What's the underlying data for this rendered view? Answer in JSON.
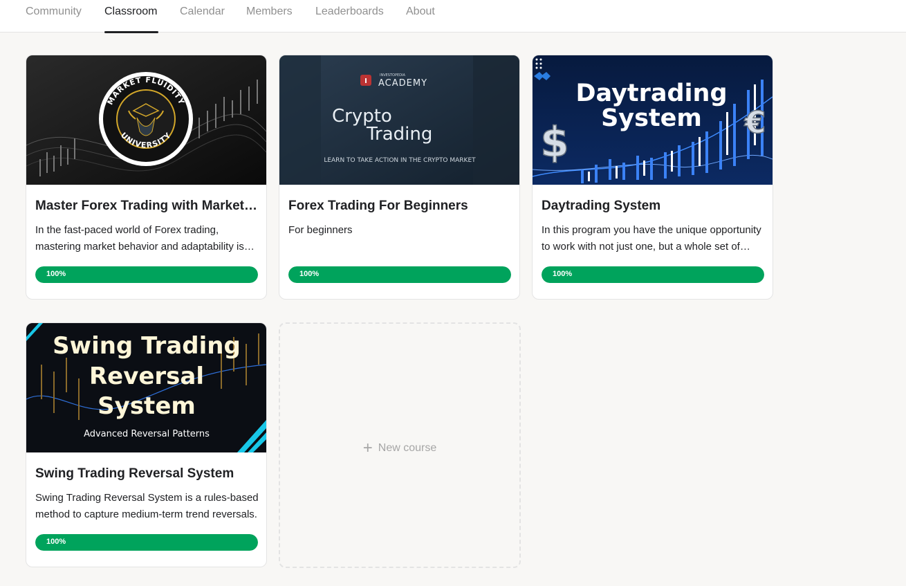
{
  "nav": {
    "tabs": [
      {
        "label": "Community"
      },
      {
        "label": "Classroom",
        "active": true
      },
      {
        "label": "Calendar"
      },
      {
        "label": "Members"
      },
      {
        "label": "Leaderboards"
      },
      {
        "label": "About"
      }
    ]
  },
  "courses": [
    {
      "title": "Master Forex Trading with Market Fluidity University",
      "description": "In the fast-paced world of Forex trading, mastering market behavior and adaptability is key to long-term success.",
      "progress_label": "100%",
      "progress": 1.0,
      "thumbnail": {
        "badge_top": "MARKET FLUIDITY",
        "badge_bottom": "UNIVERSITY"
      }
    },
    {
      "title": "Forex Trading For Beginners",
      "description": "For beginners",
      "progress_label": "100%",
      "progress": 1.0,
      "thumbnail": {
        "brand_small": "INVESTOPEDIA",
        "brand": "ACADEMY",
        "line1": "Crypto",
        "line2": "Trading",
        "tagline": "LEARN TO TAKE ACTION IN THE CRYPTO MARKET"
      }
    },
    {
      "title": "Daytrading System",
      "description": "In this program you have the unique opportunity to work with not just one, but a whole set of strategies.",
      "progress_label": "100%",
      "progress": 1.0,
      "thumbnail": {
        "line1": "Daytrading",
        "line2": "System",
        "symbol_left": "$",
        "symbol_right": "€"
      }
    },
    {
      "title": "Swing Trading Reversal System",
      "description": "Swing Trading Reversal System is a rules-based method to capture medium-term trend reversals.",
      "progress_label": "100%",
      "progress": 1.0,
      "thumbnail": {
        "line1": "Swing Trading",
        "line2": "Reversal",
        "line3": "System",
        "subtitle": "Advanced Reversal Patterns"
      }
    }
  ],
  "new_course": {
    "label": "New course",
    "icon": "plus-icon"
  },
  "colors": {
    "progress": "#00a35c",
    "active_tab": "#202124",
    "inactive_tab": "#909090"
  }
}
